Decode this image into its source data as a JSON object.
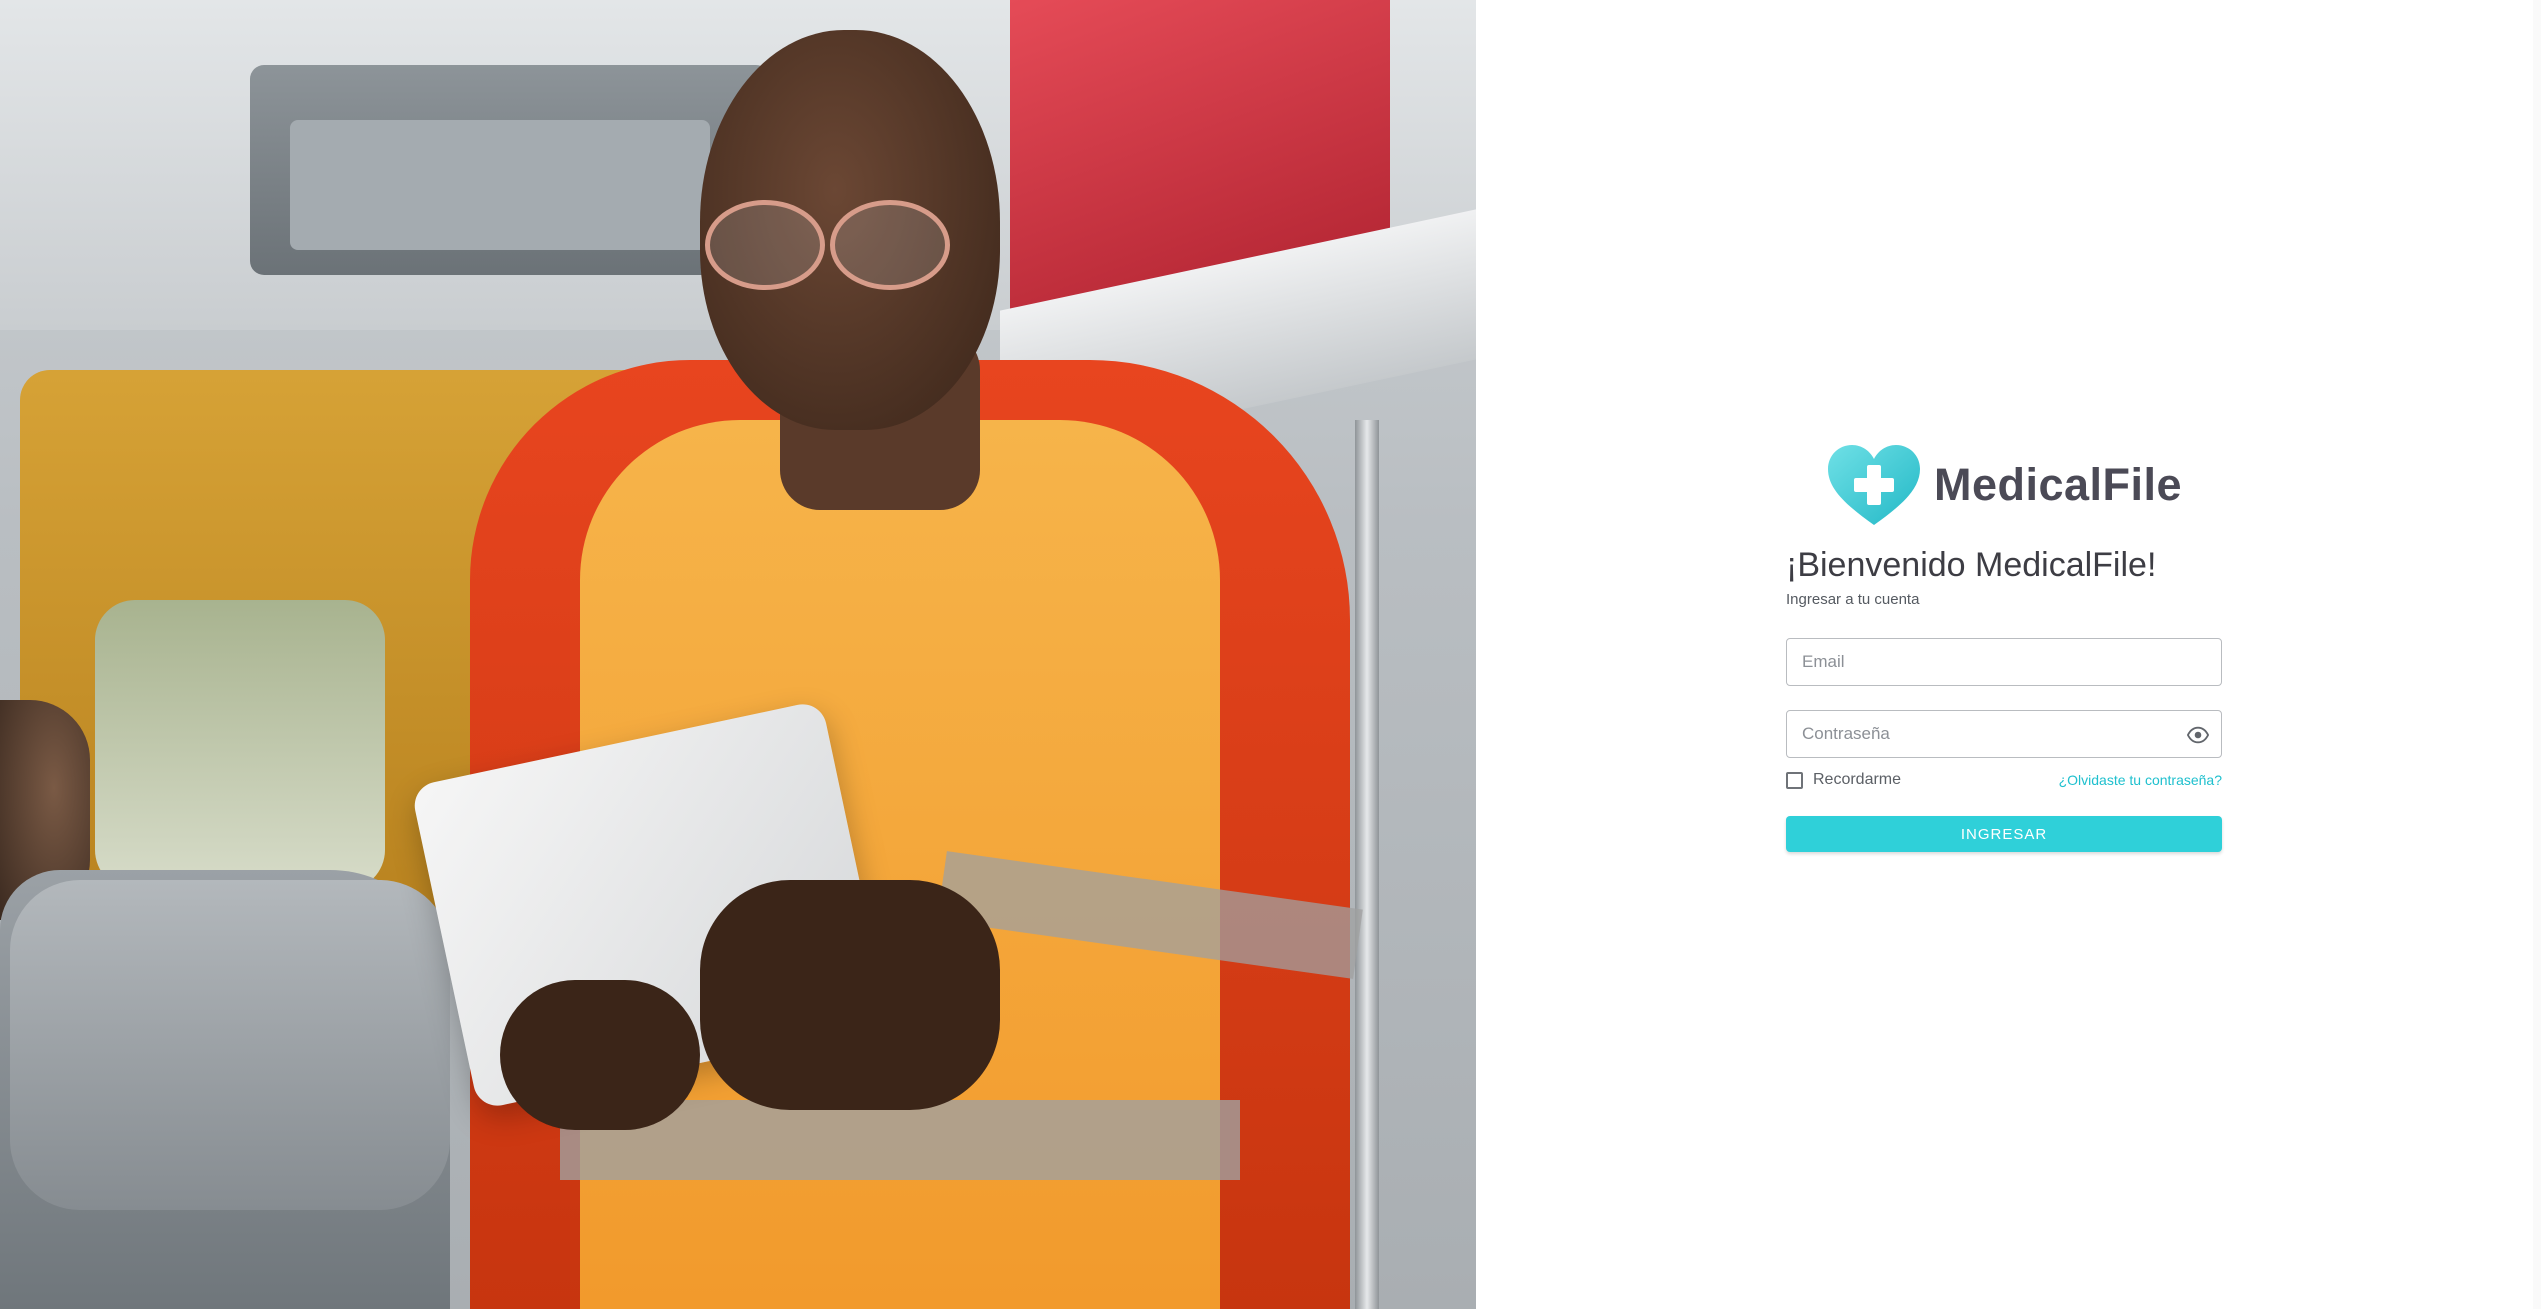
{
  "brand": {
    "name": "MedicalFile",
    "logo_icon": "heart-with-cross-icon",
    "accent_color": "#2fd0d9"
  },
  "login": {
    "title": "¡Bienvenido MedicalFile!",
    "subtitle": "Ingresar a tu cuenta",
    "email": {
      "placeholder": "Email",
      "value": ""
    },
    "password": {
      "placeholder": "Contraseña",
      "value": "",
      "toggle_icon": "eye-icon"
    },
    "remember_label": "Recordarme",
    "remember_checked": false,
    "forgot_link": "¿Olvidaste tu contraseña?",
    "submit_label": "INGRESAR"
  },
  "hero_image": {
    "description_icon": "paramedic-photo"
  }
}
